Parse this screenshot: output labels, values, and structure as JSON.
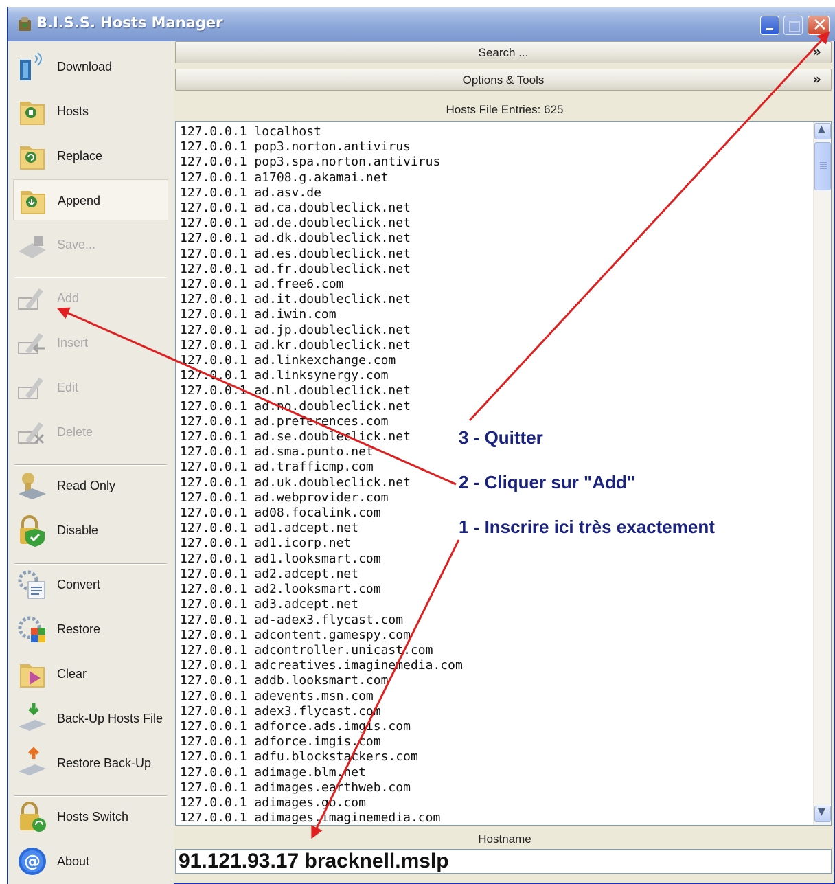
{
  "window": {
    "title": "B.I.S.S. Hosts Manager"
  },
  "sidebar": {
    "download": "Download",
    "hosts": "Hosts",
    "replace": "Replace",
    "append": "Append",
    "save": "Save...",
    "add": "Add",
    "insert": "Insert",
    "edit": "Edit",
    "delete": "Delete",
    "read_only": "Read Only",
    "disable": "Disable",
    "convert": "Convert",
    "restore": "Restore",
    "clear": "Clear",
    "backup": "Back-Up Hosts File",
    "restore_backup": "Restore Back-Up",
    "hosts_switch": "Hosts Switch",
    "about": "About"
  },
  "main": {
    "search_label": "Search ...",
    "options_label": "Options & Tools",
    "entries_label": "Hosts File Entries: 625",
    "hostname_label": "Hostname",
    "hostname_value": "91.121.93.17 bracknell.mslp"
  },
  "entries": [
    "127.0.0.1 localhost",
    "127.0.0.1 pop3.norton.antivirus",
    "127.0.0.1 pop3.spa.norton.antivirus",
    "127.0.0.1 a1708.g.akamai.net",
    "127.0.0.1 ad.asv.de",
    "127.0.0.1 ad.ca.doubleclick.net",
    "127.0.0.1 ad.de.doubleclick.net",
    "127.0.0.1 ad.dk.doubleclick.net",
    "127.0.0.1 ad.es.doubleclick.net",
    "127.0.0.1 ad.fr.doubleclick.net",
    "127.0.0.1 ad.free6.com",
    "127.0.0.1 ad.it.doubleclick.net",
    "127.0.0.1 ad.iwin.com",
    "127.0.0.1 ad.jp.doubleclick.net",
    "127.0.0.1 ad.kr.doubleclick.net",
    "127.0.0.1 ad.linkexchange.com",
    "127.0.0.1 ad.linksynergy.com",
    "127.0.0.1 ad.nl.doubleclick.net",
    "127.0.0.1 ad.no.doubleclick.net",
    "127.0.0.1 ad.preferences.com",
    "127.0.0.1 ad.se.doubleclick.net",
    "127.0.0.1 ad.sma.punto.net",
    "127.0.0.1 ad.trafficmp.com",
    "127.0.0.1 ad.uk.doubleclick.net",
    "127.0.0.1 ad.webprovider.com",
    "127.0.0.1 ad08.focalink.com",
    "127.0.0.1 ad1.adcept.net",
    "127.0.0.1 ad1.icorp.net",
    "127.0.0.1 ad1.looksmart.com",
    "127.0.0.1 ad2.adcept.net",
    "127.0.0.1 ad2.looksmart.com",
    "127.0.0.1 ad3.adcept.net",
    "127.0.0.1 ad-adex3.flycast.com",
    "127.0.0.1 adcontent.gamespy.com",
    "127.0.0.1 adcontroller.unicast.com",
    "127.0.0.1 adcreatives.imaginemedia.com",
    "127.0.0.1 addb.looksmart.com",
    "127.0.0.1 adevents.msn.com",
    "127.0.0.1 adex3.flycast.com",
    "127.0.0.1 adforce.ads.imgis.com",
    "127.0.0.1 adforce.imgis.com",
    "127.0.0.1 adfu.blockstackers.com",
    "127.0.0.1 adimage.blm.net",
    "127.0.0.1 adimages.earthweb.com",
    "127.0.0.1 adimages.go.com",
    "127.0.0.1 adimages.imaginemedia.com"
  ],
  "annotations": {
    "step3": "3 - Quitter",
    "step2": "2 - Cliquer sur \"Add\"",
    "step1": "1 - Inscrire ici très exactement"
  },
  "colors": {
    "annotation_arrow": "#e02020",
    "annotation_text": "#1a2280",
    "titlebar": "#8ba6d8"
  }
}
